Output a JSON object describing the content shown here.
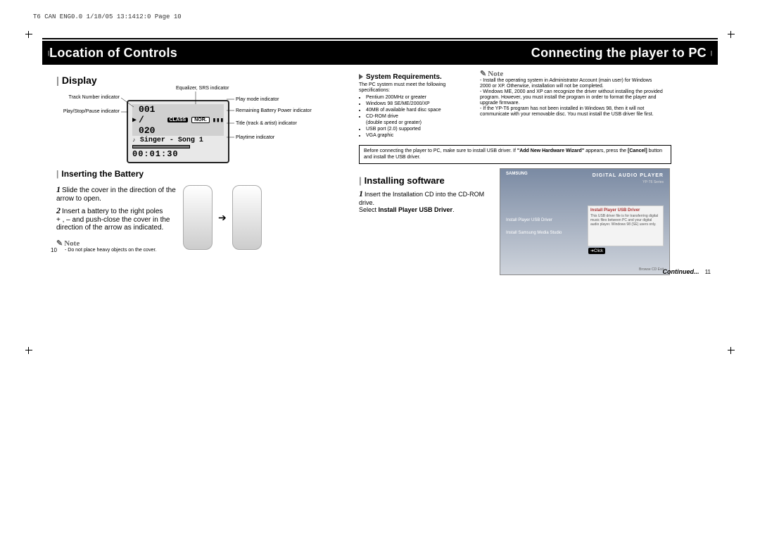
{
  "header_line": "T6 CAN ENG0.0  1/18/05 13:1412:0  Page 10",
  "left": {
    "title": "Location of Controls",
    "display": {
      "heading": "Display",
      "track": "001 / 020",
      "song": "Singer - Song 1",
      "time": "00:01:30",
      "badge_class": "CLASS",
      "badge_nor": "NOR.",
      "labels": {
        "track_num": "Track Number indicator",
        "eq_srs": "Equalizer, SRS indicator",
        "play_mode": "Play mode indicator",
        "battery": "Remaining Battery Power indicator",
        "title_artist": "Title (track & artist) indicator",
        "playtime": "Playtime indicator",
        "playstop": "Play/Stop/Pause indicator"
      }
    },
    "battery": {
      "heading": "Inserting the Battery",
      "step1": "Slide the cover in the direction of the arrow to open.",
      "step2a": "Insert a battery to the right poles",
      "step2b": "+ , – and push-close the cover in the direction of the arrow as indicated.",
      "note_label": "Note",
      "note_text": "- Do not place heavy objects on the cover."
    },
    "page_num": "10"
  },
  "right": {
    "title": "Connecting the player to PC",
    "sysreq": {
      "heading": "System Requirements.",
      "intro": "The PC system must meet the following specifications:",
      "items": [
        "Pentium 200MHz or greater",
        "Windows 98 SE/ME/2000/XP",
        "40MB of available hard disc space",
        "CD-ROM drive",
        "(double speed or greater)",
        "USB port (2.0) supported",
        "VGA graphic"
      ]
    },
    "note": {
      "label": "Note",
      "lines": [
        "- Install the operating system in Administrator Account (main user) for Windows 2000 or XP. Otherwise, installation will not be completed.",
        "- Windows ME, 2000 and XP can recognize the driver without installing the provided program. However, you must install the program in order to format the player and upgrade firmware.",
        "- If the YP-T6 program has not been installed in Windows 98, then it will not communicate with your removable disc. You must install the USB driver file first."
      ]
    },
    "warnbox": {
      "line1_a": "Before connecting the player to PC, make sure to install USB driver. If ",
      "line1_b": "\"Add New Hardware Wizard\"",
      "line1_c": " appears, press the ",
      "line1_d": "[Cancel]",
      "line1_e": " button and install the USB driver."
    },
    "install": {
      "heading": "Installing software",
      "step1a": "Insert the Installation CD into the CD-ROM drive.",
      "step1b_prefix": "Select ",
      "step1b_bold": "Install Player USB Driver",
      "step1b_suffix": "."
    },
    "screenshot": {
      "brand": "DIGITAL AUDIO PLAYER",
      "model": "YP-T6 Series",
      "panel_title": "Install Player USB Driver",
      "panel_body": "This USB driver file is for transferring digital music files between PC and your digital audio player. Windows 98 (SE) users only.",
      "menu1": "Install Player USB Driver",
      "menu2": "Install Samsung Media Studio",
      "click": "Click",
      "footer": "Browse CD        Exit"
    },
    "continued": "Continued...",
    "page_num": "11"
  }
}
